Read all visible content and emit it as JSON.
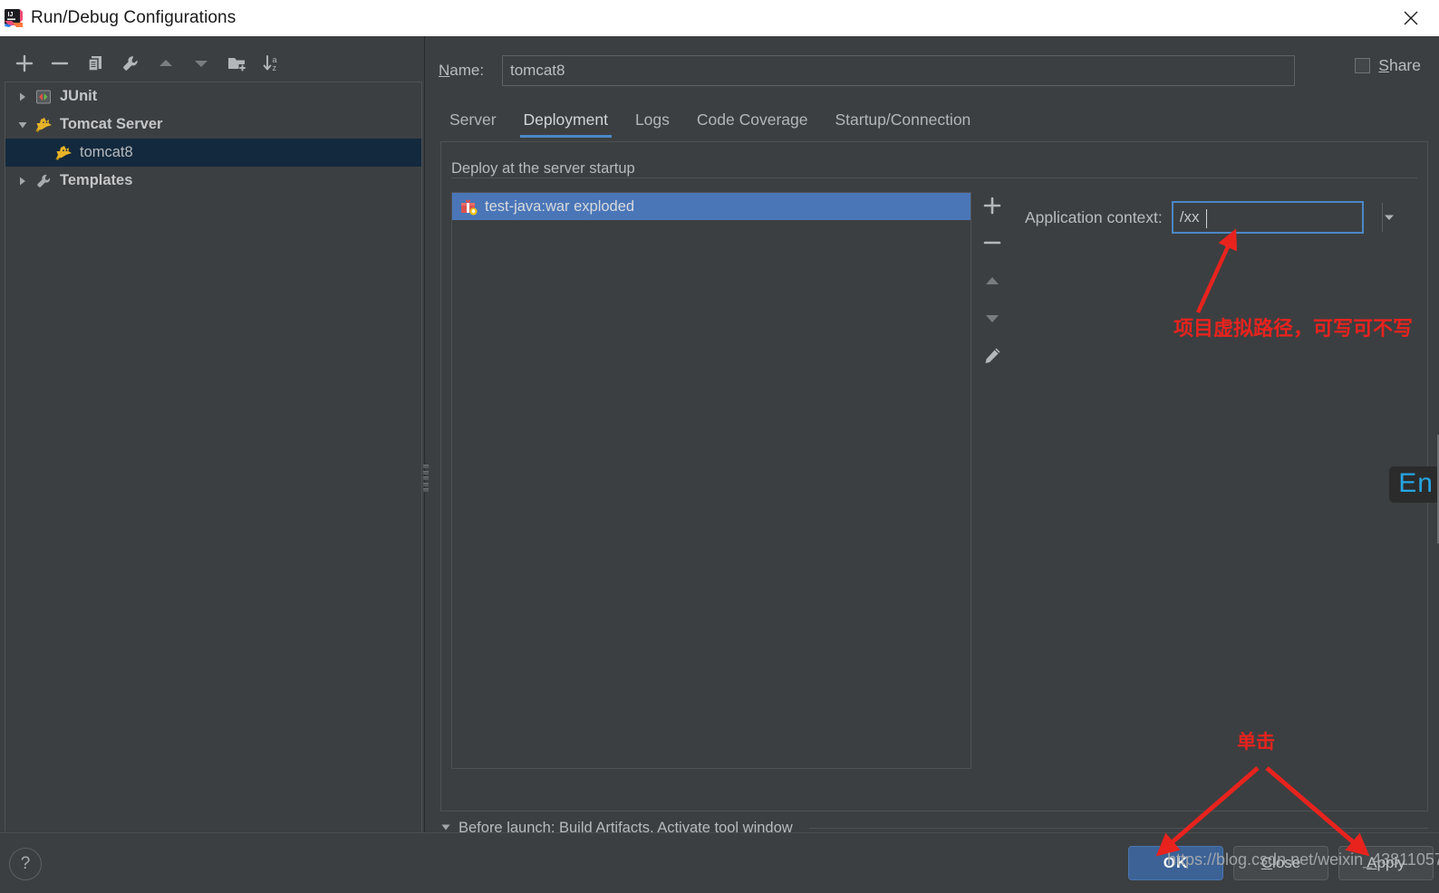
{
  "window": {
    "title": "Run/Debug Configurations",
    "app_icon": "intellij-idea-icon",
    "close_label": "✕"
  },
  "left_toolbar": {
    "buttons": [
      {
        "name": "add-configuration-button",
        "glyph": "+",
        "label": "Add New Configuration",
        "dim": false
      },
      {
        "name": "remove-configuration-button",
        "glyph": "−",
        "label": "Remove Configuration",
        "dim": false
      },
      {
        "name": "copy-configuration-button",
        "glyph": "copy-icon",
        "label": "Copy Configuration",
        "dim": false
      },
      {
        "name": "edit-defaults-button",
        "glyph": "wrench-icon",
        "label": "Edit defaults",
        "dim": false
      },
      {
        "name": "move-up-button",
        "glyph": "▲",
        "label": "Move Up",
        "dim": true
      },
      {
        "name": "move-down-button",
        "glyph": "▼",
        "label": "Move Down",
        "dim": true
      },
      {
        "name": "create-folder-button",
        "glyph": "folder-add-icon",
        "label": "Create New Folder",
        "dim": false
      },
      {
        "name": "sort-configurations-button",
        "glyph": "sort-az-icon",
        "label": "Sort Configurations",
        "dim": false
      }
    ]
  },
  "tree": {
    "items": [
      {
        "label": "JUnit",
        "level": 1,
        "expanded": false,
        "arrow": "▶",
        "icon": "junit-icon",
        "selected": false,
        "bold": true
      },
      {
        "label": "Tomcat Server",
        "level": 1,
        "expanded": true,
        "arrow": "▼",
        "icon": "tomcat-icon",
        "selected": false,
        "bold": true
      },
      {
        "label": "tomcat8",
        "level": 2,
        "expanded": false,
        "arrow": "",
        "icon": "tomcat-icon",
        "selected": true,
        "bold": false
      },
      {
        "label": "Templates",
        "level": 1,
        "expanded": false,
        "arrow": "▶",
        "icon": "wrench-icon",
        "selected": false,
        "bold": true
      }
    ]
  },
  "form": {
    "name_label_prefix": "N",
    "name_label_rest": "ame:",
    "name_value": "tomcat8",
    "share_label_prefix": "S",
    "share_label_rest": "hare",
    "share_checked": false
  },
  "tabs": [
    {
      "label": "Server",
      "active": false
    },
    {
      "label": "Deployment",
      "active": true
    },
    {
      "label": "Logs",
      "active": false
    },
    {
      "label": "Code Coverage",
      "active": false
    },
    {
      "label": "Startup/Connection",
      "active": false
    }
  ],
  "deployment": {
    "group_title": "Deploy at the server startup",
    "artifacts": [
      {
        "label": "test-java:war exploded",
        "icon": "artifact-gift-icon",
        "selected": true
      }
    ],
    "list_buttons": [
      {
        "name": "add-artifact-button",
        "glyph": "+",
        "dim": false
      },
      {
        "name": "remove-artifact-button",
        "glyph": "−",
        "dim": false
      },
      {
        "name": "move-artifact-up-button",
        "glyph": "▲",
        "dim": true
      },
      {
        "name": "move-artifact-down-button",
        "glyph": "▼",
        "dim": true
      },
      {
        "name": "edit-artifact-button",
        "glyph": "pencil-icon",
        "dim": false
      }
    ],
    "application_context_label": "Application context:",
    "application_context_value": "/xx"
  },
  "before_launch": {
    "arrow": "▼",
    "text": "Before launch: Build Artifacts, Activate tool window"
  },
  "bottom": {
    "help_glyph": "?",
    "buttons": [
      {
        "name": "ok-button",
        "label": "OK",
        "primary": true,
        "mnemonic": ""
      },
      {
        "name": "close-button",
        "label": "Close",
        "primary": false,
        "mnemonic": "C"
      },
      {
        "name": "apply-button",
        "label": "Apply",
        "primary": false,
        "mnemonic": "A"
      }
    ]
  },
  "annotations": {
    "application_context_note": "项目虚拟路径，可写可不写",
    "click_note": "单击",
    "color": "#e8231e"
  },
  "watermark": "https://blog.csdn.net/weixin_43811057",
  "ime_indicator": "En",
  "colors": {
    "window_bg": "#3c3f41",
    "titlebar_bg": "#ffffff",
    "selection_tree": "#13293d",
    "selection_list": "#4a76b8",
    "accent_tab": "#4a88c7",
    "focus_border": "#4a88c7",
    "primary_button": "#3c6296",
    "annotation_red": "#e8231e",
    "ime_cyan": "#26a5e4"
  }
}
